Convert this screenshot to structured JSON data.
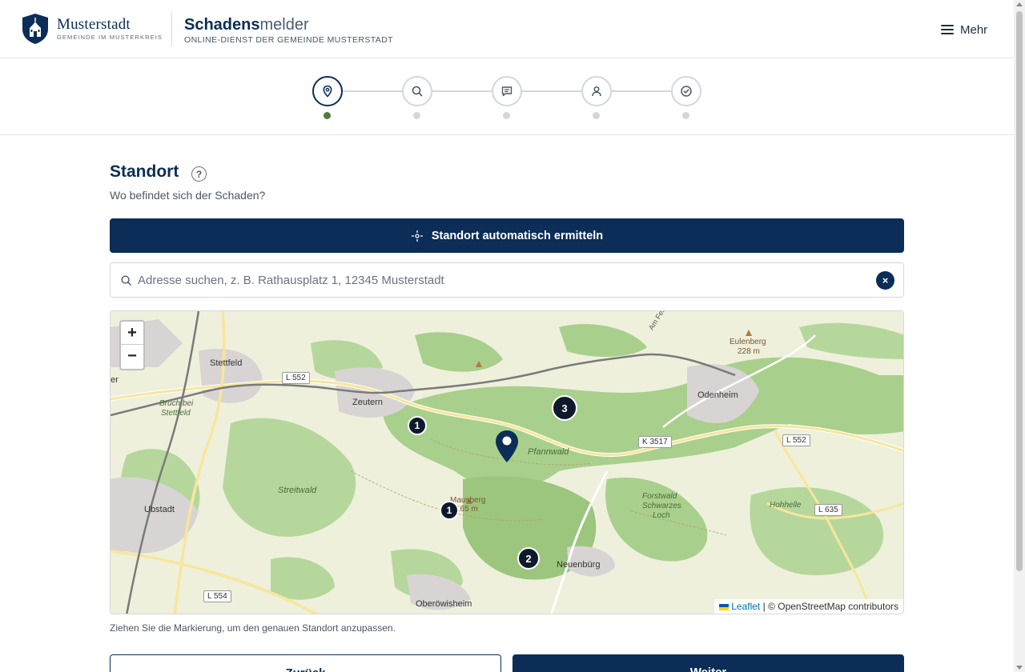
{
  "header": {
    "brand_name": "Musterstadt",
    "brand_sub": "Gemeinde im Musterkreis",
    "app_title_bold": "Schadens",
    "app_title_light": "melder",
    "app_subtitle": "Online-Dienst der Gemeinde Musterstadt",
    "menu_label": "Mehr",
    "menu_icon": "hamburger-icon",
    "logo_icon": "shield-crest-icon"
  },
  "stepper": {
    "steps": [
      {
        "icon": "location-pin-icon",
        "active": true
      },
      {
        "icon": "search-icon",
        "active": false
      },
      {
        "icon": "message-icon",
        "active": false
      },
      {
        "icon": "user-icon",
        "active": false
      },
      {
        "icon": "check-circle-icon",
        "active": false
      }
    ]
  },
  "location": {
    "title": "Standort",
    "help_symbol": "?",
    "subtitle": "Wo befindet sich der Schaden?",
    "locate_button": "Standort automatisch ermitteln",
    "search_placeholder": "Adresse suchen, z. B. Rathausplatz 1, 12345 Musterstadt",
    "search_value": "",
    "clear_symbol": "×",
    "hint": "Ziehen Sie die Markierung, um den genauen Standort anzupassen."
  },
  "map": {
    "zoom_in": "+",
    "zoom_out": "−",
    "attribution_link": "Leaflet",
    "attribution_text": " | © OpenStreetMap contributors",
    "place_labels": [
      "Stettfeld",
      "Zeutern",
      "Odenheim",
      "Ubstadt",
      "Neuenbürg",
      "Oberöwisheim",
      "er"
    ],
    "terrain_labels": [
      "Bruch bei",
      "Stettfeld",
      "Streitwald",
      "Pfannwald",
      "Forstwald",
      "Schwarzes",
      "Loch",
      "Hohhelle",
      "Eulenberg",
      "228 m",
      "Mausberg",
      "165 m",
      "Am Felsenkeller"
    ],
    "road_labels": [
      "L 552",
      "K 3517",
      "L 552",
      "L 635",
      "L 554"
    ],
    "clusters": [
      {
        "count": "1"
      },
      {
        "count": "3"
      },
      {
        "count": "1"
      },
      {
        "count": "2"
      }
    ],
    "colors": {
      "background": "#eef0dc",
      "forest": "#a9cf8c",
      "forest_dark": "#8fbf73",
      "road": "#f7e69c",
      "rail": "#7a7a7a",
      "town": "#d8d4d4"
    }
  },
  "actions": {
    "back_label": "Zurück",
    "next_label": "Weiter"
  },
  "theme": {
    "primary": "#0b2d57",
    "step_active_dot": "#4f7c39"
  }
}
